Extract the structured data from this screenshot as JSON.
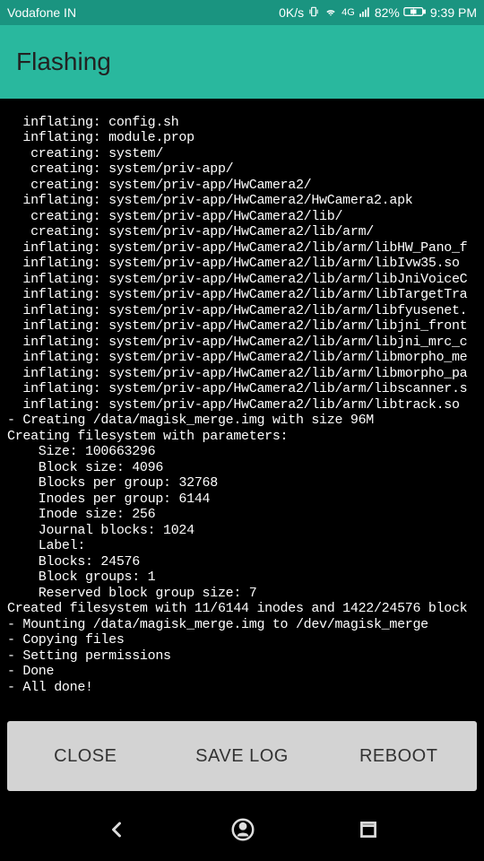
{
  "status_bar": {
    "carrier": "Vodafone IN",
    "speed": "0K/s",
    "signal_type": "4G",
    "battery_percent": "82%",
    "time": "9:39 PM"
  },
  "header": {
    "title": "Flashing"
  },
  "terminal_lines": [
    "  inflating: config.sh",
    "  inflating: module.prop",
    "   creating: system/",
    "   creating: system/priv-app/",
    "   creating: system/priv-app/HwCamera2/",
    "  inflating: system/priv-app/HwCamera2/HwCamera2.apk",
    "   creating: system/priv-app/HwCamera2/lib/",
    "   creating: system/priv-app/HwCamera2/lib/arm/",
    "  inflating: system/priv-app/HwCamera2/lib/arm/libHW_Pano_f",
    "  inflating: system/priv-app/HwCamera2/lib/arm/libIvw35.so",
    "  inflating: system/priv-app/HwCamera2/lib/arm/libJniVoiceC",
    "  inflating: system/priv-app/HwCamera2/lib/arm/libTargetTra",
    "  inflating: system/priv-app/HwCamera2/lib/arm/libfyusenet.",
    "  inflating: system/priv-app/HwCamera2/lib/arm/libjni_front",
    "  inflating: system/priv-app/HwCamera2/lib/arm/libjni_mrc_c",
    "  inflating: system/priv-app/HwCamera2/lib/arm/libmorpho_me",
    "  inflating: system/priv-app/HwCamera2/lib/arm/libmorpho_pa",
    "  inflating: system/priv-app/HwCamera2/lib/arm/libscanner.s",
    "  inflating: system/priv-app/HwCamera2/lib/arm/libtrack.so",
    "- Creating /data/magisk_merge.img with size 96M",
    "Creating filesystem with parameters:",
    "    Size: 100663296",
    "    Block size: 4096",
    "    Blocks per group: 32768",
    "    Inodes per group: 6144",
    "    Inode size: 256",
    "    Journal blocks: 1024",
    "    Label:",
    "    Blocks: 24576",
    "    Block groups: 1",
    "    Reserved block group size: 7",
    "Created filesystem with 11/6144 inodes and 1422/24576 block",
    "- Mounting /data/magisk_merge.img to /dev/magisk_merge",
    "- Copying files",
    "- Setting permissions",
    "- Done",
    "- All done!"
  ],
  "buttons": {
    "close": "CLOSE",
    "save_log": "SAVE LOG",
    "reboot": "REBOOT"
  }
}
